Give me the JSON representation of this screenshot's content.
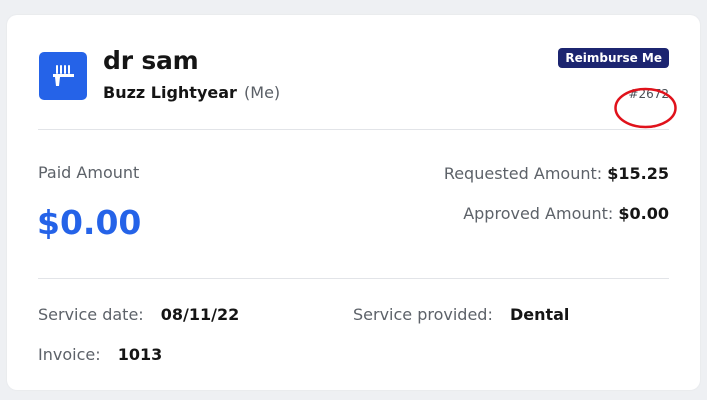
{
  "claim": {
    "provider_name": "dr sam",
    "member_name": "Buzz Lightyear",
    "member_suffix": "(Me)",
    "badge": "Reimburse Me",
    "claim_id": "#2672",
    "icon": "toothbrush-icon"
  },
  "amounts": {
    "paid_label": "Paid Amount",
    "paid_value": "$0.00",
    "requested_label": "Requested Amount:",
    "requested_value": "$15.25",
    "approved_label": "Approved Amount:",
    "approved_value": "$0.00"
  },
  "details": {
    "service_date_label": "Service date:",
    "service_date_value": "08/11/22",
    "service_provided_label": "Service provided:",
    "service_provided_value": "Dental",
    "invoice_label": "Invoice:",
    "invoice_value": "1013"
  },
  "colors": {
    "accent": "#2563e8",
    "badge_bg": "#1c2570",
    "annotation": "#e0121b"
  }
}
